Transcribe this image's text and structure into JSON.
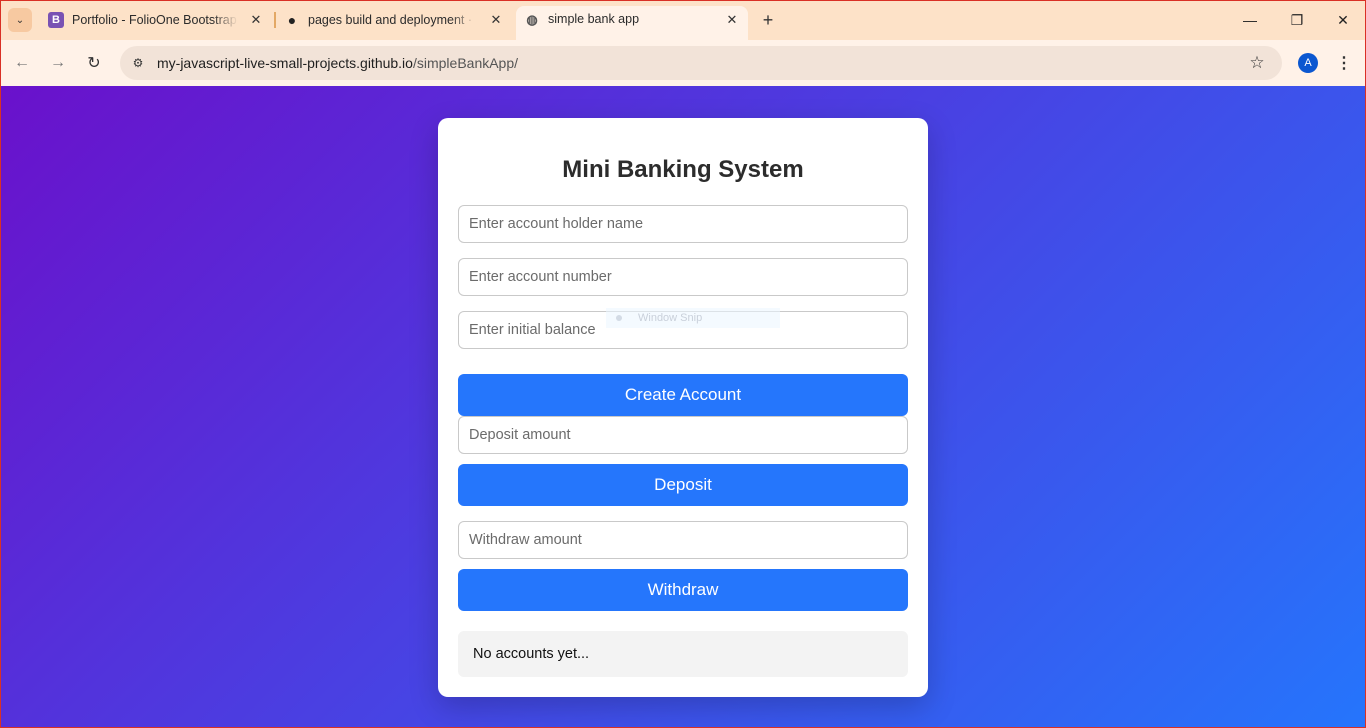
{
  "browser": {
    "tabs": [
      {
        "title": "Portfolio - FolioOne Bootstrap T",
        "favicon": "bootstrap-icon",
        "favicon_letter": "B",
        "close": "✕"
      },
      {
        "title": "pages build and deployment · M",
        "favicon": "github-icon",
        "favicon_glyph": "●",
        "close": "✕"
      },
      {
        "title": "simple bank app",
        "favicon": "globe-icon",
        "favicon_glyph": "◍",
        "close": "✕",
        "active": true
      }
    ],
    "tab_search_glyph": "⌄",
    "new_tab_glyph": "+",
    "window_controls": {
      "minimize": "—",
      "restore": "❐",
      "close": "✕"
    },
    "nav": {
      "back": "←",
      "forward": "→",
      "reload": "↻"
    },
    "site_info_glyph": "⚙",
    "url_host": "my-javascript-live-small-projects.github.io",
    "url_path": "/simpleBankApp/",
    "star_glyph": "☆",
    "profile_initial": "A",
    "menu_glyph": "⋮"
  },
  "app": {
    "title": "Mini Banking System",
    "inputs": {
      "holder_name_placeholder": "Enter account holder name",
      "account_number_placeholder": "Enter account number",
      "initial_balance_placeholder": "Enter initial balance",
      "deposit_amount_placeholder": "Deposit amount",
      "withdraw_amount_placeholder": "Withdraw amount"
    },
    "buttons": {
      "create": "Create Account",
      "deposit": "Deposit",
      "withdraw": "Withdraw"
    },
    "accounts_empty_text": "No accounts yet..."
  },
  "overlay": {
    "snip_label": "Window Snip"
  },
  "colors": {
    "gradient_start": "#6a11cb",
    "gradient_end": "#2575fc",
    "button": "#2576fc",
    "tab_strip": "#fde2c8"
  }
}
